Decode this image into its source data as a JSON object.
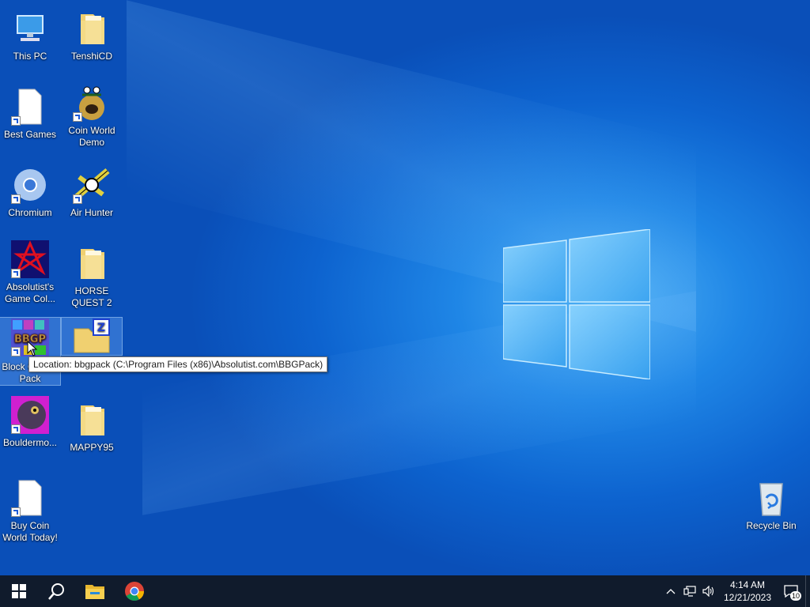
{
  "desktop": {
    "icons": [
      {
        "label": "This PC",
        "icon": "computer-icon"
      },
      {
        "label": "TenshiCD",
        "icon": "folder-icon"
      },
      {
        "label": "Best Games",
        "icon": "document-icon"
      },
      {
        "label": "Coin World Demo",
        "icon": "coin-world-icon"
      },
      {
        "label": "Chromium",
        "icon": "chromium-icon"
      },
      {
        "label": "Air Hunter",
        "icon": "air-hunter-icon"
      },
      {
        "label": "Absolutist's Game Col...",
        "icon": "absolutist-icon"
      },
      {
        "label": "HORSE QUEST 2",
        "icon": "folder-icon"
      },
      {
        "label": "Block Golden Pack",
        "icon": "bbgp-icon"
      },
      {
        "label": "",
        "icon": "zip-folder-icon"
      },
      {
        "label": "Bouldermo...",
        "icon": "bouldermouse-icon"
      },
      {
        "label": "MAPPY95",
        "icon": "folder-icon"
      },
      {
        "label": "Buy Coin World Today!",
        "icon": "document-icon"
      },
      {
        "label": "Recycle Bin",
        "icon": "recycle-bin-icon"
      }
    ],
    "tooltip": "Location: bbgpack (C:\\Program Files (x86)\\Absolutist.com\\BBGPack)",
    "bbgp_text": "BBGP"
  },
  "taskbar": {
    "time": "4:14 AM",
    "date": "12/21/2023",
    "notification_count": "10",
    "pinned": [
      "start-icon",
      "search-icon",
      "file-explorer-icon",
      "chrome-icon"
    ]
  },
  "colors": {
    "taskbar": "#101b2c",
    "desktop_blue": "#0d63cf",
    "highlight": "#1e5bd6"
  }
}
